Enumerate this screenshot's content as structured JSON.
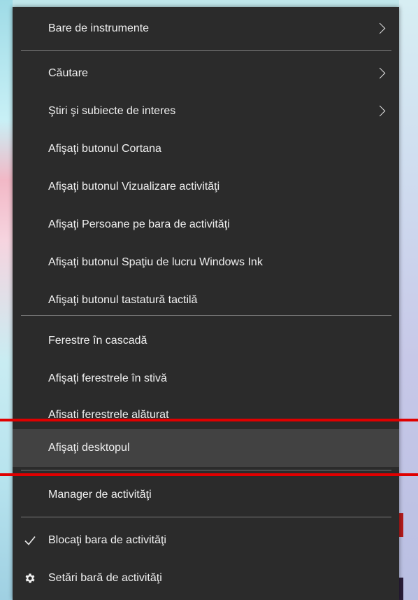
{
  "menu": {
    "items": [
      {
        "label": "Bare de instrumente",
        "submenu": true
      },
      {
        "label": "Căutare",
        "submenu": true
      },
      {
        "label": "Ştiri şi subiecte de interes",
        "submenu": true
      },
      {
        "label": "Afişaţi butonul Cortana"
      },
      {
        "label": "Afişaţi butonul Vizualizare activităţi"
      },
      {
        "label": "Afişaţi Persoane pe bara de activităţi"
      },
      {
        "label": "Afişaţi butonul Spaţiu de lucru Windows Ink"
      },
      {
        "label": "Afişaţi butonul tastatură tactilă"
      },
      {
        "label": "Ferestre în cascadă"
      },
      {
        "label": "Afişaţi ferestrele în stivă"
      },
      {
        "label": "Afisati ferestrele alăturat"
      },
      {
        "label": "Afişaţi desktopul",
        "highlighted": true
      },
      {
        "label": "Manager de activităţi"
      },
      {
        "label": "Blocaţi bara de activităţi",
        "checked": true,
        "icon": "check-icon"
      },
      {
        "label": "Setări bară de activităţi",
        "icon": "gear-icon"
      }
    ]
  },
  "colors": {
    "menu_bg": "#2b2b2b",
    "hover_bg": "#424242",
    "separator": "#7a7a7a",
    "annotation_red": "#e00000"
  }
}
